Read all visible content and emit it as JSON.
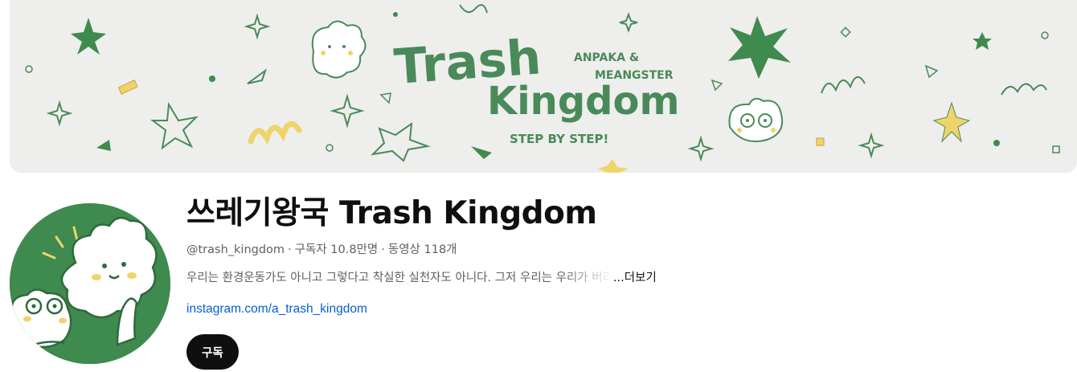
{
  "banner": {
    "title_line1": "Trash",
    "title_line2": "Kingdom",
    "credit_line1": "ANPAKA &",
    "credit_line2": "MEANGSTER",
    "tagline": "STEP BY STEP!"
  },
  "channel": {
    "title": "쓰레기왕국 Trash Kingdom",
    "handle": "@trash_kingdom",
    "separator": "·",
    "subscribers": "구독자 10.8만명",
    "videos": "동영상 118개",
    "description": "우리는 환경운동가도 아니고 그렇다고 착실한 실천자도 아니다. 그저 우리는 우리가 버리",
    "more_label": "...더보기",
    "link": "instagram.com/a_trash_kingdom"
  },
  "actions": {
    "subscribe_label": "구독"
  },
  "colors": {
    "banner_green": "#4a8a5a",
    "banner_yellow": "#efd46a",
    "avatar_green": "#3f8a4e",
    "subscribe_bg": "#0f0f0f",
    "link_blue": "#065fd4"
  }
}
